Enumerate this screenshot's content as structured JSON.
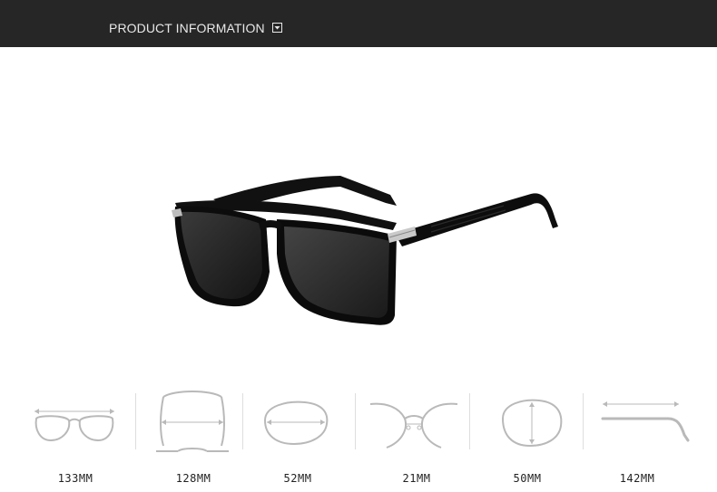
{
  "header": {
    "title": "PRODUCT INFORMATION",
    "toggle_icon": "chevron-down-icon"
  },
  "product": {
    "image_icon": "sunglasses-image"
  },
  "dimensions": [
    {
      "icon": "total-width-icon",
      "label": "133MM"
    },
    {
      "icon": "frame-width-icon",
      "label": "128MM"
    },
    {
      "icon": "lens-width-icon",
      "label": "52MM"
    },
    {
      "icon": "bridge-width-icon",
      "label": "21MM"
    },
    {
      "icon": "lens-height-icon",
      "label": "50MM"
    },
    {
      "icon": "temple-length-icon",
      "label": "142MM"
    }
  ]
}
